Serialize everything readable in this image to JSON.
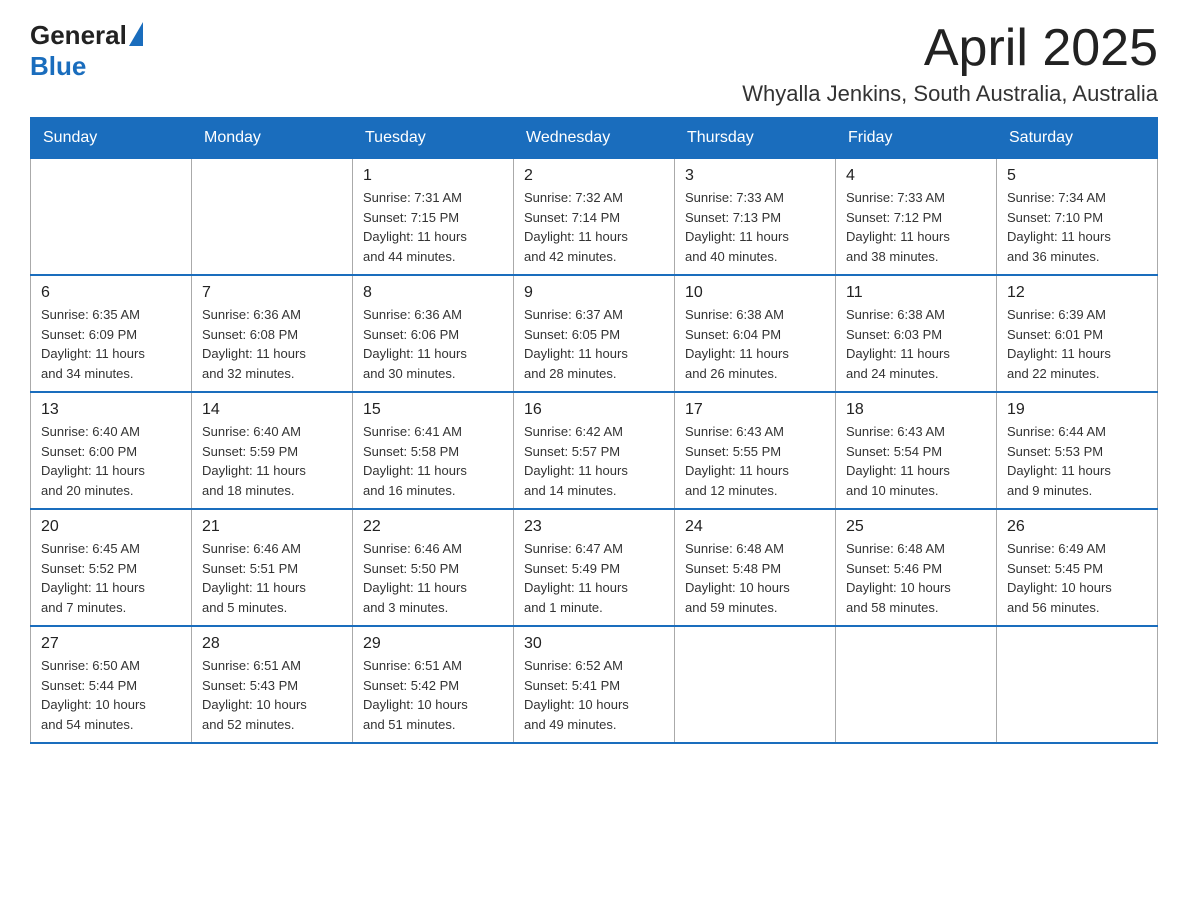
{
  "header": {
    "logo_general": "General",
    "logo_blue": "Blue",
    "title": "April 2025",
    "subtitle": "Whyalla Jenkins, South Australia, Australia"
  },
  "calendar": {
    "days_of_week": [
      "Sunday",
      "Monday",
      "Tuesday",
      "Wednesday",
      "Thursday",
      "Friday",
      "Saturday"
    ],
    "weeks": [
      [
        {
          "day": "",
          "info": ""
        },
        {
          "day": "",
          "info": ""
        },
        {
          "day": "1",
          "info": "Sunrise: 7:31 AM\nSunset: 7:15 PM\nDaylight: 11 hours\nand 44 minutes."
        },
        {
          "day": "2",
          "info": "Sunrise: 7:32 AM\nSunset: 7:14 PM\nDaylight: 11 hours\nand 42 minutes."
        },
        {
          "day": "3",
          "info": "Sunrise: 7:33 AM\nSunset: 7:13 PM\nDaylight: 11 hours\nand 40 minutes."
        },
        {
          "day": "4",
          "info": "Sunrise: 7:33 AM\nSunset: 7:12 PM\nDaylight: 11 hours\nand 38 minutes."
        },
        {
          "day": "5",
          "info": "Sunrise: 7:34 AM\nSunset: 7:10 PM\nDaylight: 11 hours\nand 36 minutes."
        }
      ],
      [
        {
          "day": "6",
          "info": "Sunrise: 6:35 AM\nSunset: 6:09 PM\nDaylight: 11 hours\nand 34 minutes."
        },
        {
          "day": "7",
          "info": "Sunrise: 6:36 AM\nSunset: 6:08 PM\nDaylight: 11 hours\nand 32 minutes."
        },
        {
          "day": "8",
          "info": "Sunrise: 6:36 AM\nSunset: 6:06 PM\nDaylight: 11 hours\nand 30 minutes."
        },
        {
          "day": "9",
          "info": "Sunrise: 6:37 AM\nSunset: 6:05 PM\nDaylight: 11 hours\nand 28 minutes."
        },
        {
          "day": "10",
          "info": "Sunrise: 6:38 AM\nSunset: 6:04 PM\nDaylight: 11 hours\nand 26 minutes."
        },
        {
          "day": "11",
          "info": "Sunrise: 6:38 AM\nSunset: 6:03 PM\nDaylight: 11 hours\nand 24 minutes."
        },
        {
          "day": "12",
          "info": "Sunrise: 6:39 AM\nSunset: 6:01 PM\nDaylight: 11 hours\nand 22 minutes."
        }
      ],
      [
        {
          "day": "13",
          "info": "Sunrise: 6:40 AM\nSunset: 6:00 PM\nDaylight: 11 hours\nand 20 minutes."
        },
        {
          "day": "14",
          "info": "Sunrise: 6:40 AM\nSunset: 5:59 PM\nDaylight: 11 hours\nand 18 minutes."
        },
        {
          "day": "15",
          "info": "Sunrise: 6:41 AM\nSunset: 5:58 PM\nDaylight: 11 hours\nand 16 minutes."
        },
        {
          "day": "16",
          "info": "Sunrise: 6:42 AM\nSunset: 5:57 PM\nDaylight: 11 hours\nand 14 minutes."
        },
        {
          "day": "17",
          "info": "Sunrise: 6:43 AM\nSunset: 5:55 PM\nDaylight: 11 hours\nand 12 minutes."
        },
        {
          "day": "18",
          "info": "Sunrise: 6:43 AM\nSunset: 5:54 PM\nDaylight: 11 hours\nand 10 minutes."
        },
        {
          "day": "19",
          "info": "Sunrise: 6:44 AM\nSunset: 5:53 PM\nDaylight: 11 hours\nand 9 minutes."
        }
      ],
      [
        {
          "day": "20",
          "info": "Sunrise: 6:45 AM\nSunset: 5:52 PM\nDaylight: 11 hours\nand 7 minutes."
        },
        {
          "day": "21",
          "info": "Sunrise: 6:46 AM\nSunset: 5:51 PM\nDaylight: 11 hours\nand 5 minutes."
        },
        {
          "day": "22",
          "info": "Sunrise: 6:46 AM\nSunset: 5:50 PM\nDaylight: 11 hours\nand 3 minutes."
        },
        {
          "day": "23",
          "info": "Sunrise: 6:47 AM\nSunset: 5:49 PM\nDaylight: 11 hours\nand 1 minute."
        },
        {
          "day": "24",
          "info": "Sunrise: 6:48 AM\nSunset: 5:48 PM\nDaylight: 10 hours\nand 59 minutes."
        },
        {
          "day": "25",
          "info": "Sunrise: 6:48 AM\nSunset: 5:46 PM\nDaylight: 10 hours\nand 58 minutes."
        },
        {
          "day": "26",
          "info": "Sunrise: 6:49 AM\nSunset: 5:45 PM\nDaylight: 10 hours\nand 56 minutes."
        }
      ],
      [
        {
          "day": "27",
          "info": "Sunrise: 6:50 AM\nSunset: 5:44 PM\nDaylight: 10 hours\nand 54 minutes."
        },
        {
          "day": "28",
          "info": "Sunrise: 6:51 AM\nSunset: 5:43 PM\nDaylight: 10 hours\nand 52 minutes."
        },
        {
          "day": "29",
          "info": "Sunrise: 6:51 AM\nSunset: 5:42 PM\nDaylight: 10 hours\nand 51 minutes."
        },
        {
          "day": "30",
          "info": "Sunrise: 6:52 AM\nSunset: 5:41 PM\nDaylight: 10 hours\nand 49 minutes."
        },
        {
          "day": "",
          "info": ""
        },
        {
          "day": "",
          "info": ""
        },
        {
          "day": "",
          "info": ""
        }
      ]
    ]
  }
}
